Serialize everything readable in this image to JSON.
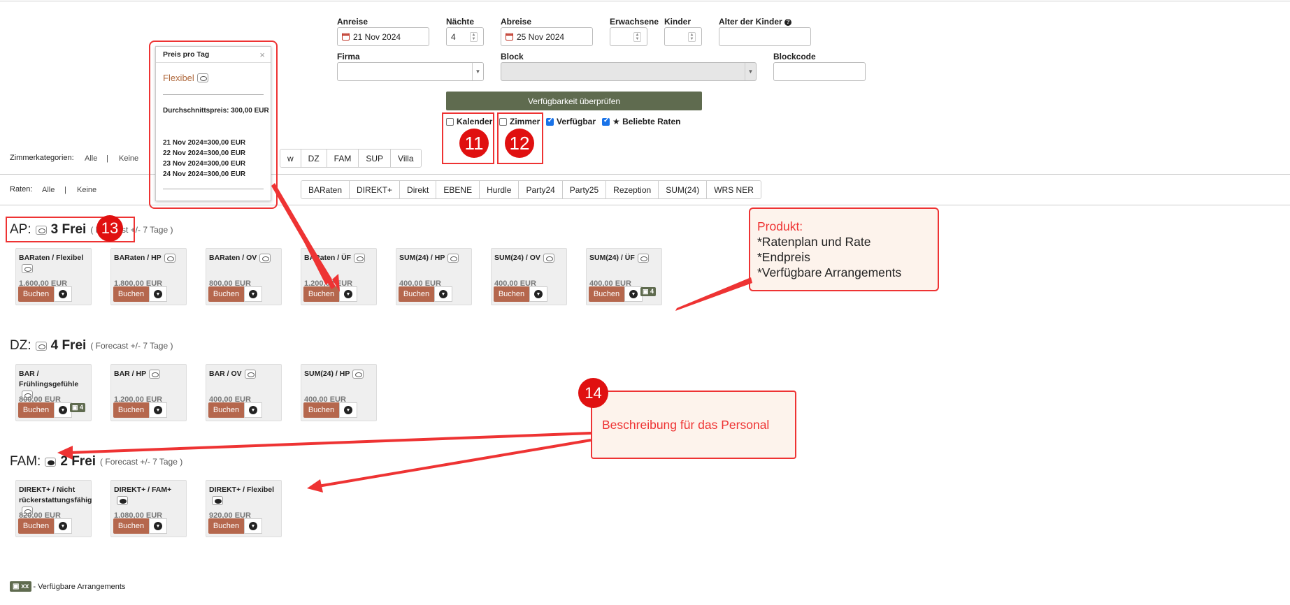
{
  "form": {
    "arrival_label": "Anreise",
    "arrival_value": "21 Nov 2024",
    "nights_label": "Nächte",
    "nights_value": "4",
    "departure_label": "Abreise",
    "departure_value": "25 Nov 2024",
    "adults_label": "Erwachsene",
    "children_label": "Kinder",
    "child_age_label": "Alter der Kinder",
    "company_label": "Firma",
    "block_label": "Block",
    "blockcode_label": "Blockcode",
    "check_button": "Verfügbarkeit überprüfen"
  },
  "options": {
    "kalender": "Kalender",
    "zimmer": "Zimmer",
    "verfuegbar": "Verfügbar",
    "beliebte": "Beliebte Raten"
  },
  "filters": {
    "categories_label": "Zimmerkategorien:",
    "all": "Alle",
    "sep": "|",
    "none": "Keine",
    "categories": [
      "w",
      "DZ",
      "FAM",
      "SUP",
      "Villa"
    ],
    "rates_label": "Raten:",
    "rates": [
      "BARaten",
      "DIREKT+",
      "Direkt",
      "EBENE",
      "Hurdle",
      "Party24",
      "Party25",
      "Rezeption",
      "SUM(24)",
      "WRS NER"
    ]
  },
  "popup": {
    "title": "Preis pro Tag",
    "close": "×",
    "rate": "Flexibel",
    "avg": "Durchschnittspreis: 300,00 EUR",
    "days": [
      "21 Nov 2024=300,00 EUR",
      "22 Nov 2024=300,00 EUR",
      "23 Nov 2024=300,00 EUR",
      "24 Nov 2024=300,00 EUR"
    ]
  },
  "sections": [
    {
      "code": "AP:",
      "free": "3 Frei",
      "forecast": "( Forecast +/- 7 Tage )",
      "cards": [
        {
          "title": "BARaten / Flexibel",
          "price": "1.600,00 EUR"
        },
        {
          "title": "BARaten / HP",
          "price": "1.800,00 EUR"
        },
        {
          "title": "BARaten / OV",
          "price": "800,00 EUR"
        },
        {
          "title": "BARaten / ÜF",
          "price": "1.200,00 EUR"
        },
        {
          "title": "SUM(24) / HP",
          "price": "400,00 EUR"
        },
        {
          "title": "SUM(24) / OV",
          "price": "400,00 EUR"
        },
        {
          "title": "SUM(24) / ÜF",
          "price": "400,00 EUR",
          "arr": "4"
        }
      ]
    },
    {
      "code": "DZ:",
      "free": "4 Frei",
      "forecast": "( Forecast +/- 7 Tage )",
      "cards": [
        {
          "title": "BAR / Frühlingsgefühle",
          "price": "800,00 EUR",
          "arr": "4"
        },
        {
          "title": "BAR / HP",
          "price": "1.200,00 EUR"
        },
        {
          "title": "BAR / OV",
          "price": "400,00 EUR"
        },
        {
          "title": "SUM(24) / HP",
          "price": "400,00 EUR"
        }
      ]
    },
    {
      "code": "FAM:",
      "free": "2 Frei",
      "forecast": "( Forecast +/- 7 Tage )",
      "cards": [
        {
          "title": "DIREKT+ / Nicht rückerstattungsfähig",
          "price": "820,00 EUR"
        },
        {
          "title": "DIREKT+ / FAM+",
          "price": "1.080,00 EUR"
        },
        {
          "title": "DIREKT+ / Flexibel",
          "price": "920,00 EUR"
        }
      ]
    }
  ],
  "book_label": "Buchen",
  "legend": {
    "badge": "xx",
    "text": "- Verfügbare Arrangements"
  },
  "annotations": {
    "n11": "11",
    "n12": "12",
    "n13": "13",
    "n14": "14",
    "produkt_title": "Produkt:",
    "produkt_lines": [
      "*Ratenplan und Rate",
      "*Endpreis",
      "*Verfügbare Arrangements"
    ],
    "beschreibung": "Beschreibung für das Personal"
  },
  "colors": {
    "book": "#b5674d",
    "check": "#5f6b4f",
    "annotation": "#e33333"
  }
}
